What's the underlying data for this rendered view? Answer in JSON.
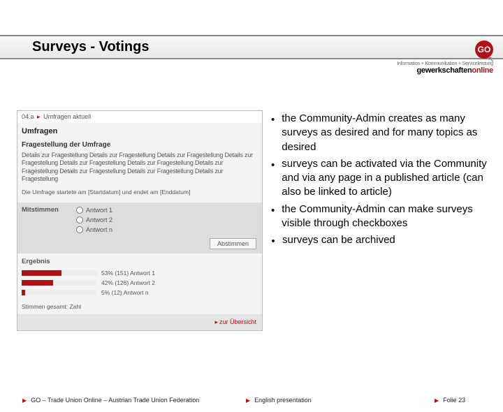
{
  "logo": {
    "badge": "GO",
    "tag1": "Information + Kommunikation + Serviceleistung",
    "tag2a": "gewerkschaften",
    "tag2b": "online"
  },
  "title": "Surveys - Votings",
  "screenshot": {
    "crumb1": "04.a",
    "crumb2": "Umfragen aktuell",
    "h1": "Umfragen",
    "h2": "Fragestellung der Umfrage",
    "desc": "Details zur Fragestellung Details zur Fragestellung Details zur Fragestellung Details zur Fragestellung Details zur Fragestellung Details zur Fragestellung Details zur Fragestellung Details zur Fragestellung Details zur Fragestellung Details zur Fragestellung",
    "start": "Die Umfrage startete am [Startdatum] und endet am [Enddatum]",
    "voteLabel": "Mitstimmen",
    "opt1": "Antwort 1",
    "opt2": "Antwort 2",
    "opt3": "Antwort n",
    "voteBtn": "Abstimmen",
    "resHead": "Ergebnis",
    "res1": {
      "pct": 53,
      "txt": "53% (151) Antwort 1"
    },
    "res2": {
      "pct": 42,
      "txt": "42% (126) Antwort 2"
    },
    "res3": {
      "pct": 5,
      "txt": "5% (12) Antwort n"
    },
    "total": "Stimmen gesamt: Zahl",
    "overview": "zur Übersicht"
  },
  "bullets": {
    "b1": "the Community-Admin creates as many surveys as desired and for many topics as desired",
    "b2": "surveys can be activated via the Community and via any page in a published article (can also be linked to article)",
    "b3": " the Community-Admin can make surveys visible through checkboxes",
    "b4": "surveys can be archived"
  },
  "footer": {
    "left": "GO – Trade Union Online – Austrian Trade Union Federation",
    "center": "English presentation",
    "right": "Folie 23"
  },
  "chart_data": {
    "type": "bar",
    "title": "Ergebnis",
    "categories": [
      "Antwort 1",
      "Antwort 2",
      "Antwort n"
    ],
    "series": [
      {
        "name": "Prozent",
        "values": [
          53,
          42,
          5
        ]
      },
      {
        "name": "Stimmen",
        "values": [
          151,
          126,
          12
        ]
      }
    ],
    "xlabel": "",
    "ylabel": "",
    "ylim": [
      0,
      100
    ]
  }
}
